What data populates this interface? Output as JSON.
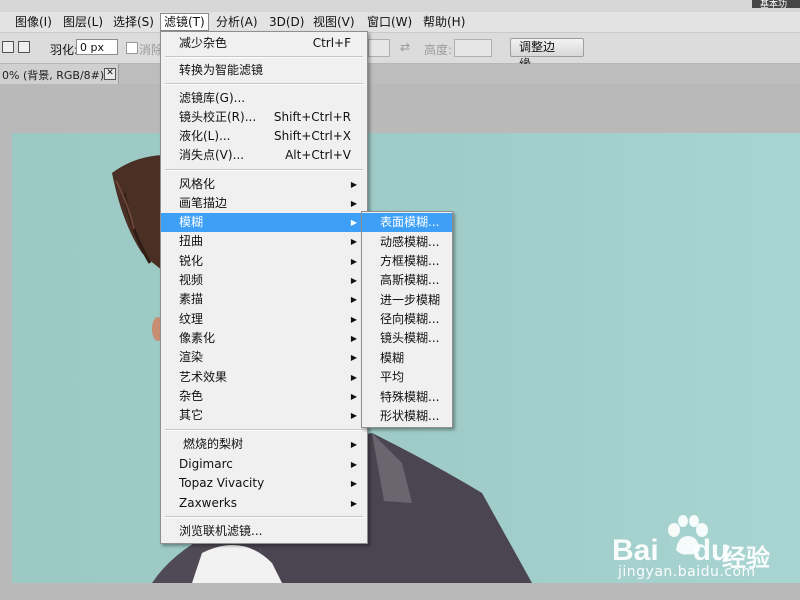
{
  "menubar": {
    "items": [
      "图像(I)",
      "图层(L)",
      "选择(S)",
      "滤镜(T)",
      "分析(A)",
      "3D(D)",
      "视图(V)",
      "窗口(W)",
      "帮助(H)"
    ]
  },
  "options": {
    "feather_label": "羽化:",
    "feather_value": "0 px",
    "antialias_label": "消除",
    "height_label": "高度:",
    "refine_edge_label": "调整边缘..."
  },
  "doc_tab": {
    "title": "0% (背景, RGB/8#) *",
    "close_glyph": "✕"
  },
  "filter_menu": {
    "items": [
      {
        "label": "减少杂色",
        "shortcut": "Ctrl+F"
      },
      {
        "label": "转换为智能滤镜"
      },
      {
        "label": "滤镜库(G)..."
      },
      {
        "label": "镜头校正(R)...",
        "shortcut": "Shift+Ctrl+R"
      },
      {
        "label": "液化(L)...",
        "shortcut": "Shift+Ctrl+X"
      },
      {
        "label": "消失点(V)...",
        "shortcut": "Alt+Ctrl+V"
      },
      {
        "label": "风格化"
      },
      {
        "label": "画笔描边"
      },
      {
        "label": "模糊"
      },
      {
        "label": "扭曲"
      },
      {
        "label": "锐化"
      },
      {
        "label": "视频"
      },
      {
        "label": "素描"
      },
      {
        "label": "纹理"
      },
      {
        "label": "像素化"
      },
      {
        "label": "渲染"
      },
      {
        "label": "艺术效果"
      },
      {
        "label": "杂色"
      },
      {
        "label": "其它"
      },
      {
        "label": "燃烧的梨树"
      },
      {
        "label": "Digimarc"
      },
      {
        "label": "Topaz Vivacity"
      },
      {
        "label": "Zaxwerks"
      },
      {
        "label": "浏览联机滤镜..."
      }
    ]
  },
  "blur_submenu": {
    "items": [
      "表面模糊...",
      "动感模糊...",
      "方框模糊...",
      "高斯模糊...",
      "进一步模糊",
      "径向模糊...",
      "镜头模糊...",
      "模糊",
      "平均",
      "特殊模糊...",
      "形状模糊..."
    ]
  },
  "watermark": {
    "brand": "Bai",
    "brand2": "du",
    "cn": "经验",
    "url": "jingyan.baidu.com"
  },
  "topbar": {
    "right_text": "基本功"
  },
  "colors": {
    "highlight": "#3d9ff5",
    "menu_bg": "#f0f0f0",
    "canvas_bg": "#9ecbc7",
    "jacket": "#4a4550"
  },
  "icons": {
    "submenu_arrow": "▶",
    "swap": "⇄"
  }
}
